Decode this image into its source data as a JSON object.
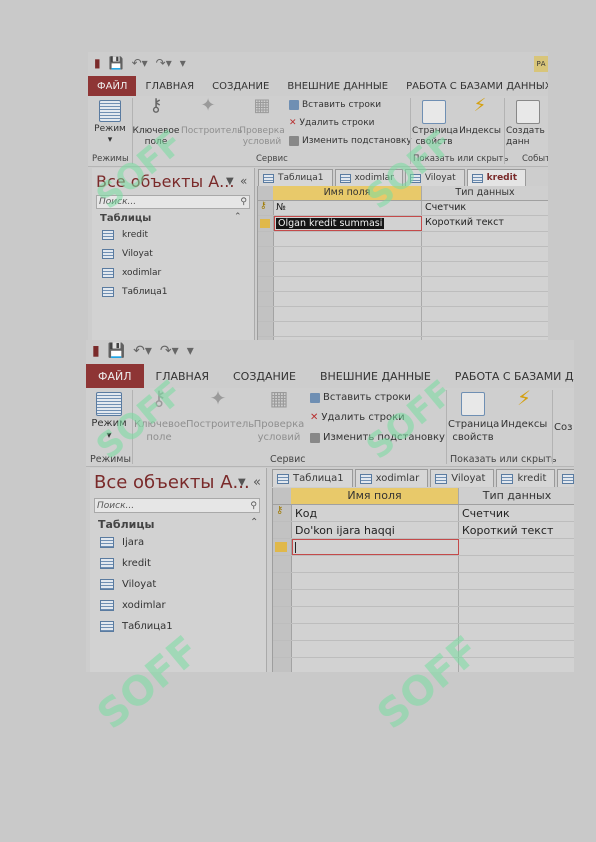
{
  "watermark": {
    "text": "SOFF"
  },
  "shot1": {
    "ribbon_tabs": [
      "ФАЙЛ",
      "ГЛАВНАЯ",
      "СОЗДАНИЕ",
      "ВНЕШНИЕ ДАННЫЕ",
      "РАБОТА С БАЗАМИ ДАННЫХ"
    ],
    "corner_badge": "РА",
    "buttons": {
      "view": "Режим",
      "key": "Ключевое поле",
      "builder": "Построитель",
      "check": "Проверка условий",
      "property_sheet": "Страница свойств",
      "indexes": "Индексы",
      "create": "Создать данн"
    },
    "small_buttons": {
      "insert_rows": "Вставить строки",
      "delete_rows": "Удалить строки",
      "change_lookup": "Изменить подстановку"
    },
    "groups": {
      "views": "Режимы",
      "tools": "Сервис",
      "show_hide": "Показать или скрыть",
      "events": "Событ"
    },
    "nav": {
      "title": "Все объекты А...",
      "search_placeholder": "Поиск...",
      "group": "Таблицы",
      "items": [
        "kredit",
        "Viloyat",
        "xodimlar",
        "Таблица1"
      ]
    },
    "doc_tabs": [
      "Таблица1",
      "xodimlar",
      "Viloyat",
      "kredit"
    ],
    "grid": {
      "headers": [
        "Имя поля",
        "Тип данных"
      ],
      "rows": [
        [
          "№",
          "Счетчик"
        ],
        [
          "Olgan kredit summasi",
          "Короткий текст"
        ]
      ]
    }
  },
  "shot2": {
    "ribbon_tabs": [
      "ФАЙЛ",
      "ГЛАВНАЯ",
      "СОЗДАНИЕ",
      "ВНЕШНИЕ ДАННЫЕ",
      "РАБОТА С БАЗАМИ ДАННЫХ"
    ],
    "buttons": {
      "view": "Режим",
      "key": "Ключевое поле",
      "builder": "Построитель",
      "check": "Проверка условий",
      "property_sheet": "Страница свойств",
      "indexes": "Индексы",
      "create": "Соз"
    },
    "small_buttons": {
      "insert_rows": "Вставить строки",
      "delete_rows": "Удалить строки",
      "change_lookup": "Изменить подстановку"
    },
    "groups": {
      "views": "Режимы",
      "tools": "Сервис",
      "show_hide": "Показать или скрыть"
    },
    "nav": {
      "title": "Все объекты А...",
      "search_placeholder": "Поиск...",
      "group": "Таблицы",
      "items": [
        "Ijara",
        "kredit",
        "Viloyat",
        "xodimlar",
        "Таблица1"
      ]
    },
    "doc_tabs": [
      "Таблица1",
      "xodimlar",
      "Viloyat",
      "kredit"
    ],
    "grid": {
      "headers": [
        "Имя поля",
        "Тип данных"
      ],
      "rows": [
        [
          "Код",
          "Счетчик"
        ],
        [
          "Do'kon ijara haqqi",
          "Короткий текст"
        ]
      ]
    }
  },
  "colors": {
    "file_tab": "#8e3535",
    "accent_red": "#7a2a2a",
    "header_gold": "#e8c96a",
    "edit_border": "#c44a4a"
  }
}
